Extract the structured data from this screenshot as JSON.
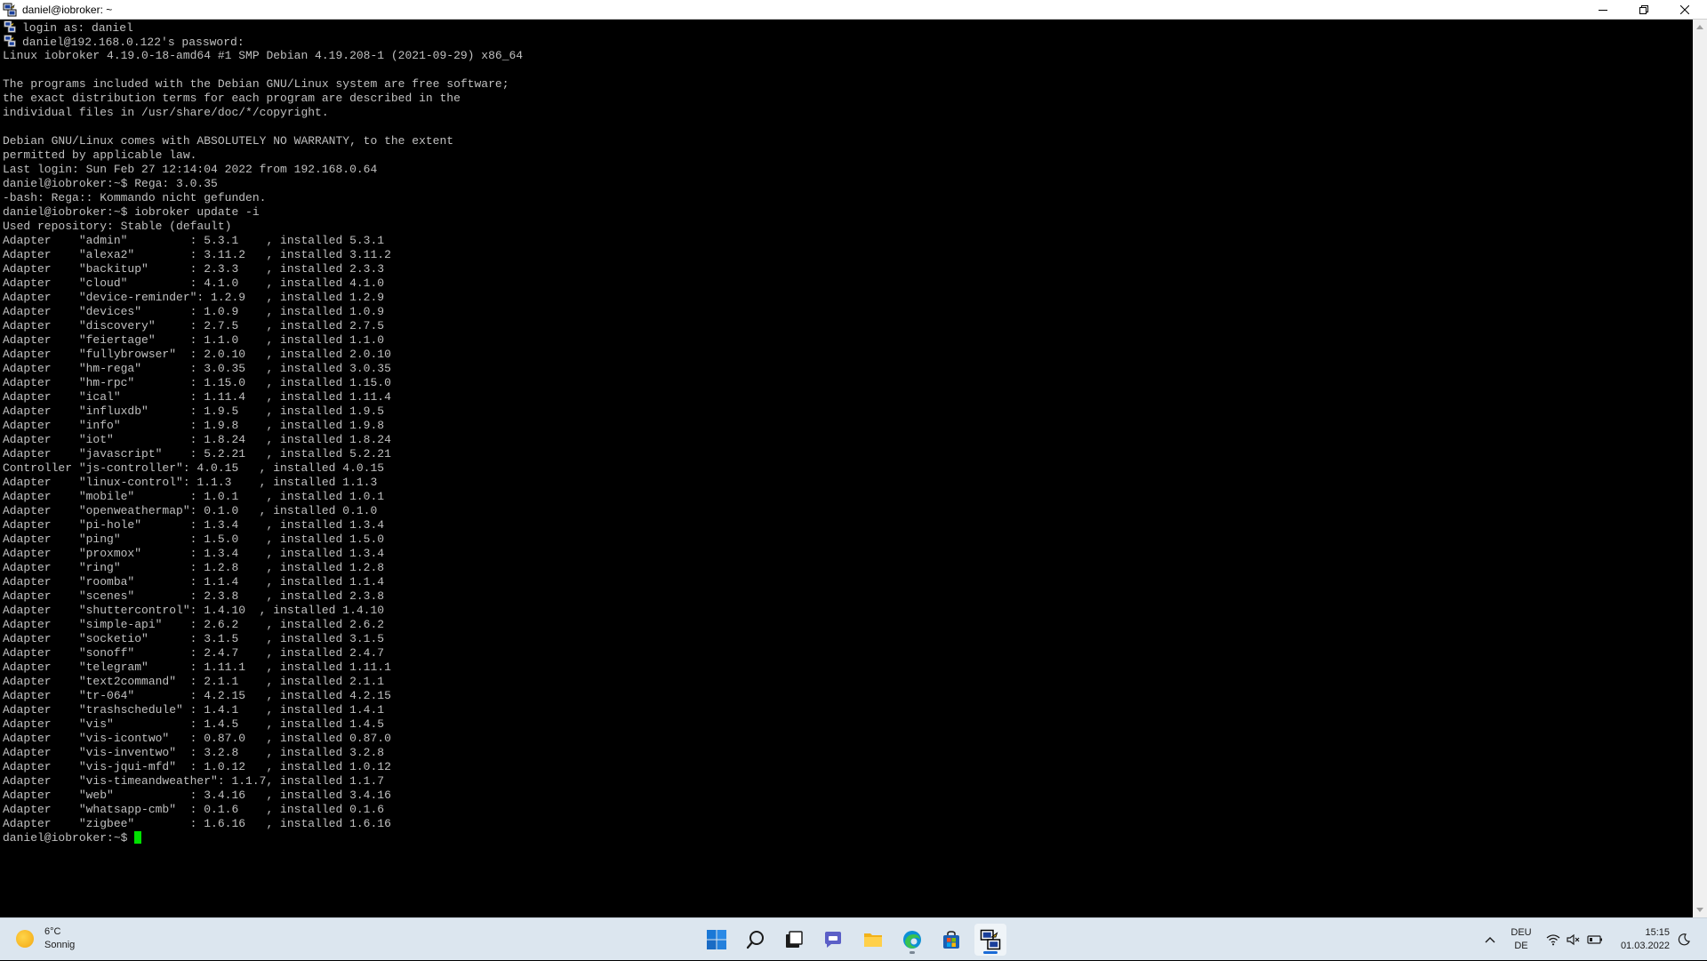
{
  "window": {
    "title": "daniel@iobroker: ~"
  },
  "terminal": {
    "lines": [
      {
        "icon": "putty-icon",
        "text": "login as: daniel"
      },
      {
        "icon": "putty-icon",
        "text": "daniel@192.168.0.122's password:"
      },
      {
        "text": "Linux iobroker 4.19.0-18-amd64 #1 SMP Debian 4.19.208-1 (2021-09-29) x86_64"
      },
      {
        "text": ""
      },
      {
        "text": "The programs included with the Debian GNU/Linux system are free software;"
      },
      {
        "text": "the exact distribution terms for each program are described in the"
      },
      {
        "text": "individual files in /usr/share/doc/*/copyright."
      },
      {
        "text": ""
      },
      {
        "text": "Debian GNU/Linux comes with ABSOLUTELY NO WARRANTY, to the extent"
      },
      {
        "text": "permitted by applicable law."
      },
      {
        "text": "Last login: Sun Feb 27 12:14:04 2022 from 192.168.0.64"
      },
      {
        "text": "daniel@iobroker:~$ Rega: 3.0.35"
      },
      {
        "text": "-bash: Rega:: Kommando nicht gefunden."
      },
      {
        "text": "daniel@iobroker:~$ iobroker update -i"
      },
      {
        "text": "Used repository: Stable (default)"
      },
      {
        "text": "Adapter    \"admin\"         : 5.3.1    , installed 5.3.1"
      },
      {
        "text": "Adapter    \"alexa2\"        : 3.11.2   , installed 3.11.2"
      },
      {
        "text": "Adapter    \"backitup\"      : 2.3.3    , installed 2.3.3"
      },
      {
        "text": "Adapter    \"cloud\"         : 4.1.0    , installed 4.1.0"
      },
      {
        "text": "Adapter    \"device-reminder\": 1.2.9   , installed 1.2.9"
      },
      {
        "text": "Adapter    \"devices\"       : 1.0.9    , installed 1.0.9"
      },
      {
        "text": "Adapter    \"discovery\"     : 2.7.5    , installed 2.7.5"
      },
      {
        "text": "Adapter    \"feiertage\"     : 1.1.0    , installed 1.1.0"
      },
      {
        "text": "Adapter    \"fullybrowser\"  : 2.0.10   , installed 2.0.10"
      },
      {
        "text": "Adapter    \"hm-rega\"       : 3.0.35   , installed 3.0.35"
      },
      {
        "text": "Adapter    \"hm-rpc\"        : 1.15.0   , installed 1.15.0"
      },
      {
        "text": "Adapter    \"ical\"          : 1.11.4   , installed 1.11.4"
      },
      {
        "text": "Adapter    \"influxdb\"      : 1.9.5    , installed 1.9.5"
      },
      {
        "text": "Adapter    \"info\"          : 1.9.8    , installed 1.9.8"
      },
      {
        "text": "Adapter    \"iot\"           : 1.8.24   , installed 1.8.24"
      },
      {
        "text": "Adapter    \"javascript\"    : 5.2.21   , installed 5.2.21"
      },
      {
        "text": "Controller \"js-controller\": 4.0.15   , installed 4.0.15"
      },
      {
        "text": "Adapter    \"linux-control\": 1.1.3    , installed 1.1.3"
      },
      {
        "text": "Adapter    \"mobile\"        : 1.0.1    , installed 1.0.1"
      },
      {
        "text": "Adapter    \"openweathermap\": 0.1.0   , installed 0.1.0"
      },
      {
        "text": "Adapter    \"pi-hole\"       : 1.3.4    , installed 1.3.4"
      },
      {
        "text": "Adapter    \"ping\"          : 1.5.0    , installed 1.5.0"
      },
      {
        "text": "Adapter    \"proxmox\"       : 1.3.4    , installed 1.3.4"
      },
      {
        "text": "Adapter    \"ring\"          : 1.2.8    , installed 1.2.8"
      },
      {
        "text": "Adapter    \"roomba\"        : 1.1.4    , installed 1.1.4"
      },
      {
        "text": "Adapter    \"scenes\"        : 2.3.8    , installed 2.3.8"
      },
      {
        "text": "Adapter    \"shuttercontrol\": 1.4.10  , installed 1.4.10"
      },
      {
        "text": "Adapter    \"simple-api\"    : 2.6.2    , installed 2.6.2"
      },
      {
        "text": "Adapter    \"socketio\"      : 3.1.5    , installed 3.1.5"
      },
      {
        "text": "Adapter    \"sonoff\"        : 2.4.7    , installed 2.4.7"
      },
      {
        "text": "Adapter    \"telegram\"      : 1.11.1   , installed 1.11.1"
      },
      {
        "text": "Adapter    \"text2command\"  : 2.1.1    , installed 2.1.1"
      },
      {
        "text": "Adapter    \"tr-064\"        : 4.2.15   , installed 4.2.15"
      },
      {
        "text": "Adapter    \"trashschedule\" : 1.4.1    , installed 1.4.1"
      },
      {
        "text": "Adapter    \"vis\"           : 1.4.5    , installed 1.4.5"
      },
      {
        "text": "Adapter    \"vis-icontwo\"   : 0.87.0   , installed 0.87.0"
      },
      {
        "text": "Adapter    \"vis-inventwo\"  : 3.2.8    , installed 3.2.8"
      },
      {
        "text": "Adapter    \"vis-jqui-mfd\"  : 1.0.12   , installed 1.0.12"
      },
      {
        "text": "Adapter    \"vis-timeandweather\": 1.1.7, installed 1.1.7"
      },
      {
        "text": "Adapter    \"web\"           : 3.4.16   , installed 3.4.16"
      },
      {
        "text": "Adapter    \"whatsapp-cmb\"  : 0.1.6    , installed 0.1.6"
      },
      {
        "text": "Adapter    \"zigbee\"        : 1.6.16   , installed 1.6.16"
      },
      {
        "text": "daniel@iobroker:~$ ",
        "cursor": true
      }
    ],
    "cursor_color": "#00e000"
  },
  "taskbar": {
    "weather": {
      "temp": "6°C",
      "condition": "Sonnig",
      "icon": "sun-icon"
    },
    "apps": [
      {
        "name": "start-button",
        "icon": "windows-start-icon"
      },
      {
        "name": "search-button",
        "icon": "search-icon"
      },
      {
        "name": "task-view-button",
        "icon": "task-view-icon"
      },
      {
        "name": "chat-button",
        "icon": "teams-chat-icon"
      },
      {
        "name": "file-explorer-button",
        "icon": "folder-icon"
      },
      {
        "name": "edge-button",
        "icon": "edge-icon",
        "running": true
      },
      {
        "name": "store-button",
        "icon": "store-icon"
      },
      {
        "name": "putty-button",
        "icon": "putty-icon",
        "running": true,
        "active": true
      }
    ],
    "language": {
      "line1": "DEU",
      "line2": "DE"
    },
    "clock": {
      "time": "15:15",
      "date": "01.03.2022"
    }
  }
}
